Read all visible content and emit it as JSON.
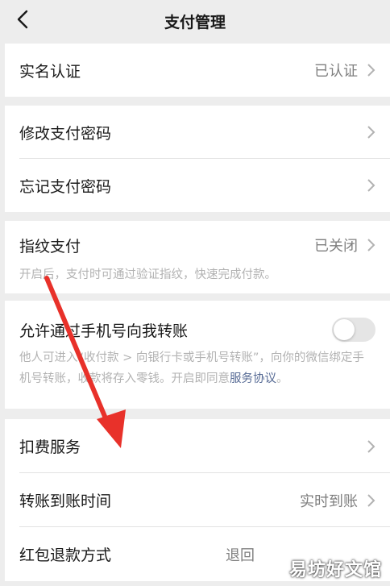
{
  "header": {
    "title": "支付管理"
  },
  "groups": {
    "realname": {
      "label": "实名认证",
      "value": "已认证"
    },
    "password": {
      "change": "修改支付密码",
      "forgot": "忘记支付密码"
    },
    "fingerprint": {
      "label": "指纹支付",
      "value": "已关闭",
      "desc": "开启后，支付时可通过验证指纹，快速完成付款。"
    },
    "phone_transfer": {
      "label": "允许通过手机号向我转账",
      "desc_prefix": "他人可进入“收付款 > 向银行卡或手机号转账”，向你的微信绑定手机号转账，收款将存入零钱。开启即同意",
      "desc_link": "服务协议",
      "desc_suffix": "。",
      "toggle_state": "off"
    },
    "services": {
      "deduction": "扣费服务",
      "arrival_label": "转账到账时间",
      "arrival_value": "实时到账",
      "refund_label": "红包退款方式",
      "refund_value": "退回"
    }
  },
  "watermark": "易坊好文馆",
  "colors": {
    "annotation_arrow": "#e8312a",
    "link": "#576b95"
  }
}
